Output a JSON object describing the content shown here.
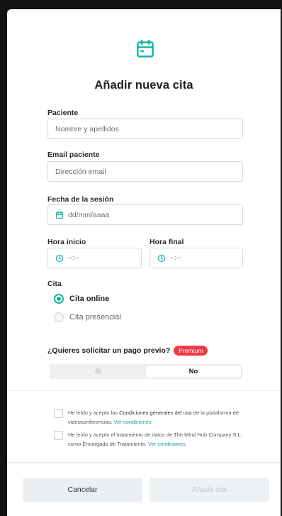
{
  "title": "Añadir nueva cita",
  "patient": {
    "label": "Paciente",
    "placeholder": "Nombre y apellidos"
  },
  "email": {
    "label": "Email paciente",
    "placeholder": "Dirección email"
  },
  "date": {
    "label": "Fecha de la sesión",
    "placeholder": "dd/mm/aaaa"
  },
  "start_time": {
    "label": "Hora inicio",
    "placeholder": "--:--"
  },
  "end_time": {
    "label": "Hora final",
    "placeholder": "--:--"
  },
  "appointment": {
    "label": "Cita",
    "options": [
      {
        "label": "Cita online",
        "selected": true
      },
      {
        "label": "Cita presencial",
        "selected": false
      }
    ]
  },
  "payment": {
    "question": "¿Quieres solicitar un pago previo?",
    "badge": "Premium",
    "yes": "Si",
    "no": "No",
    "selected": "No"
  },
  "consents": [
    {
      "text_pre": "He leído y acepto las ",
      "text_bold": "Condiciones generales del uso",
      "text_post": " de la plataforma de videoconferencias. ",
      "link": "Ver condiciones"
    },
    {
      "text_pre": "He leído y acepto el tratamiento de datos de The Mind Hub Company S.L. como Encargado de Tratamiento. ",
      "link": "Ver condiciones"
    }
  ],
  "buttons": {
    "cancel": "Cancelar",
    "add": "Añadir cita"
  },
  "colors": {
    "accent": "#17b3a2",
    "badge": "#ee3b45"
  }
}
